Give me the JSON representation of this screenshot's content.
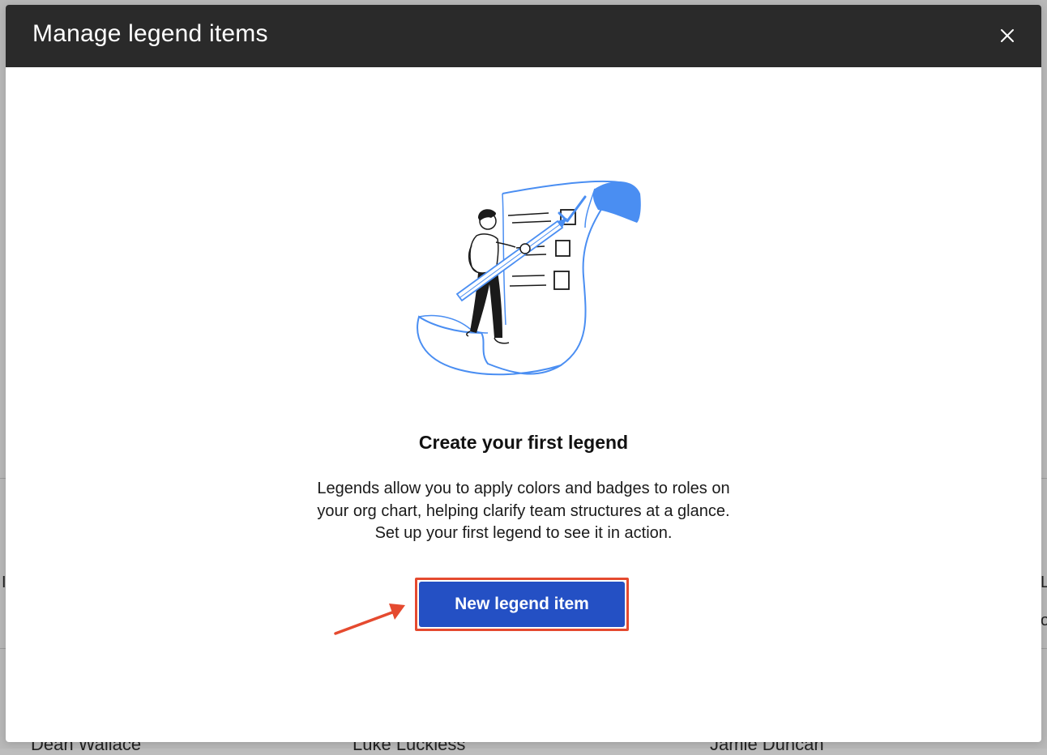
{
  "background": {
    "names": [
      "Dean Wallace",
      "Luke Luckless",
      "Jamie Duncan"
    ]
  },
  "modal": {
    "title": "Manage legend items",
    "close_icon": "close-icon"
  },
  "empty_state": {
    "illustration": "person-checklist-illustration",
    "title": "Create your first legend",
    "description_lines": [
      "Legends allow you to apply colors and badges to roles on",
      "your org chart, helping clarify team structures at a glance.",
      "Set up your first legend to see it in action."
    ],
    "button_label": "New legend item"
  },
  "annotation": {
    "arrow_icon": "arrow-icon",
    "color": "#e54a2f"
  },
  "colors": {
    "header": "#2a2a2a",
    "primary": "#2450c4",
    "illustration_accent": "#4a8ef2"
  }
}
